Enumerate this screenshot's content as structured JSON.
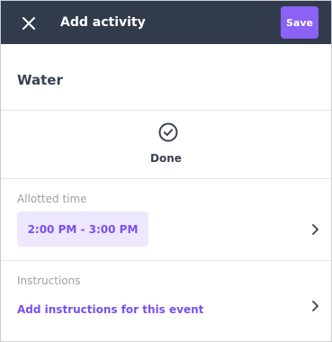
{
  "header": {
    "close_icon": "close-icon",
    "title": "Add activity",
    "save_label": "Save",
    "bg_color": "#323b4c",
    "accent_color": "#8a63f5"
  },
  "activity": {
    "name": "Water"
  },
  "status": {
    "icon": "check-circle-icon",
    "label": "Done"
  },
  "allotted_time": {
    "label": "Allotted time",
    "value": "2:00 PM - 3:00 PM",
    "chevron_icon": "chevron-right-icon"
  },
  "instructions": {
    "label": "Instructions",
    "link_text": "Add instructions for this event",
    "chevron_icon": "chevron-right-icon"
  }
}
